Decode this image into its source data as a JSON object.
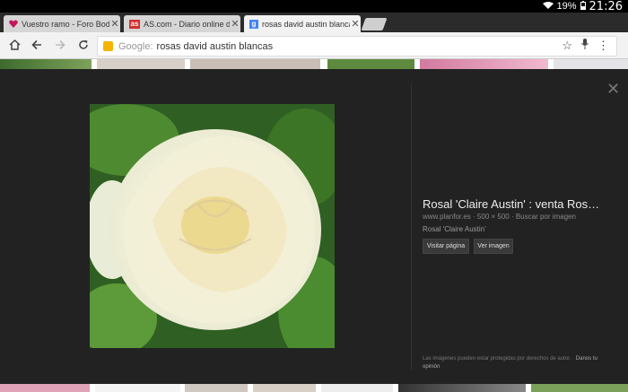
{
  "status": {
    "battery": "19%",
    "time": "21:26"
  },
  "tabs": [
    {
      "label": "Vuestro ramo - Foro Bodas",
      "favicon": "heart-icon",
      "color": "#c2185b"
    },
    {
      "label": "AS.com - Diario online depor",
      "favicon": "as-logo",
      "color": "#d32f2f"
    },
    {
      "label": "rosas david austin blancas",
      "favicon": "google-icon",
      "color": "#4285f4"
    }
  ],
  "omnibox": {
    "prefix": "Google:",
    "query": "rosas david austin blancas"
  },
  "result": {
    "title": "Rosal 'Claire Austin' : venta Ros…",
    "meta": "www.planfor.es · 500 × 500 · Buscar por imagen",
    "caption": "Rosal 'Claire Austin'",
    "visit_label": "Visitar página",
    "view_label": "Ver imagen",
    "footer_text": "Las imágenes pueden estar protegidas por derechos de autor. ·",
    "footer_link": "Danos tu opinión"
  }
}
